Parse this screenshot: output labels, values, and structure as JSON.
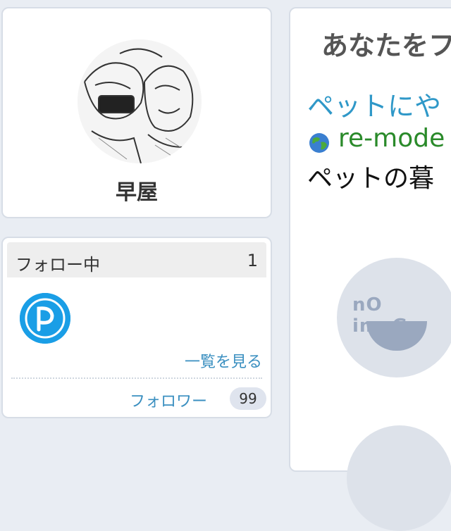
{
  "profile": {
    "name": "早屋"
  },
  "follow": {
    "title": "フォロー中",
    "count": "1",
    "see_all": "一覧を見る",
    "followers_label": "フォロワー",
    "followers_count": "99"
  },
  "main": {
    "heading": "あなたをフ",
    "article": {
      "title": "ペットにや",
      "source": "re-mode",
      "description": "ペットの暮",
      "image_placeholder": "nO imaGe"
    }
  },
  "colors": {
    "link": "#3a8fc0",
    "source": "#2a8a2a",
    "page_background": "#e9edf3"
  }
}
